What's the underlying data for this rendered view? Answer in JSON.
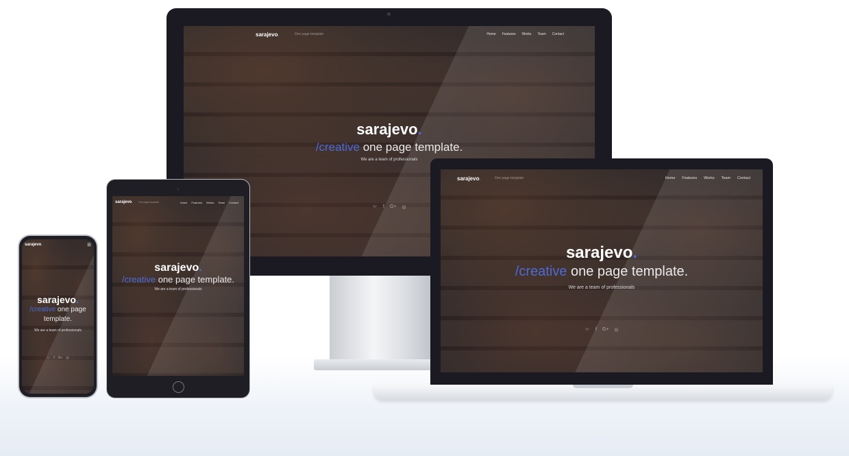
{
  "site": {
    "logo": "sarajevo",
    "logo_dot": ".",
    "tagline": "One page template",
    "nav": [
      "Home",
      "Features",
      "Works",
      "Team",
      "Contact"
    ],
    "hero_title": "sarajevo",
    "hero_title_dot": ".",
    "hero_accent": "/creative",
    "hero_subtitle": " one page template.",
    "hero_subtitle_line1": " one page",
    "hero_subtitle_line2": "template.",
    "hero_tagline": "We are a team of professionals",
    "social_icons": [
      "twitter-icon",
      "facebook-icon",
      "google-plus-icon",
      "dribbble-icon"
    ]
  },
  "colors": {
    "accent": "#4d6bd8",
    "bezel": "#1b1a22",
    "background": "#ffffff"
  },
  "icons": {
    "twitter": "🐦",
    "facebook": "f",
    "google": "G+",
    "dribbble": "◎",
    "hamburger": "≡"
  }
}
